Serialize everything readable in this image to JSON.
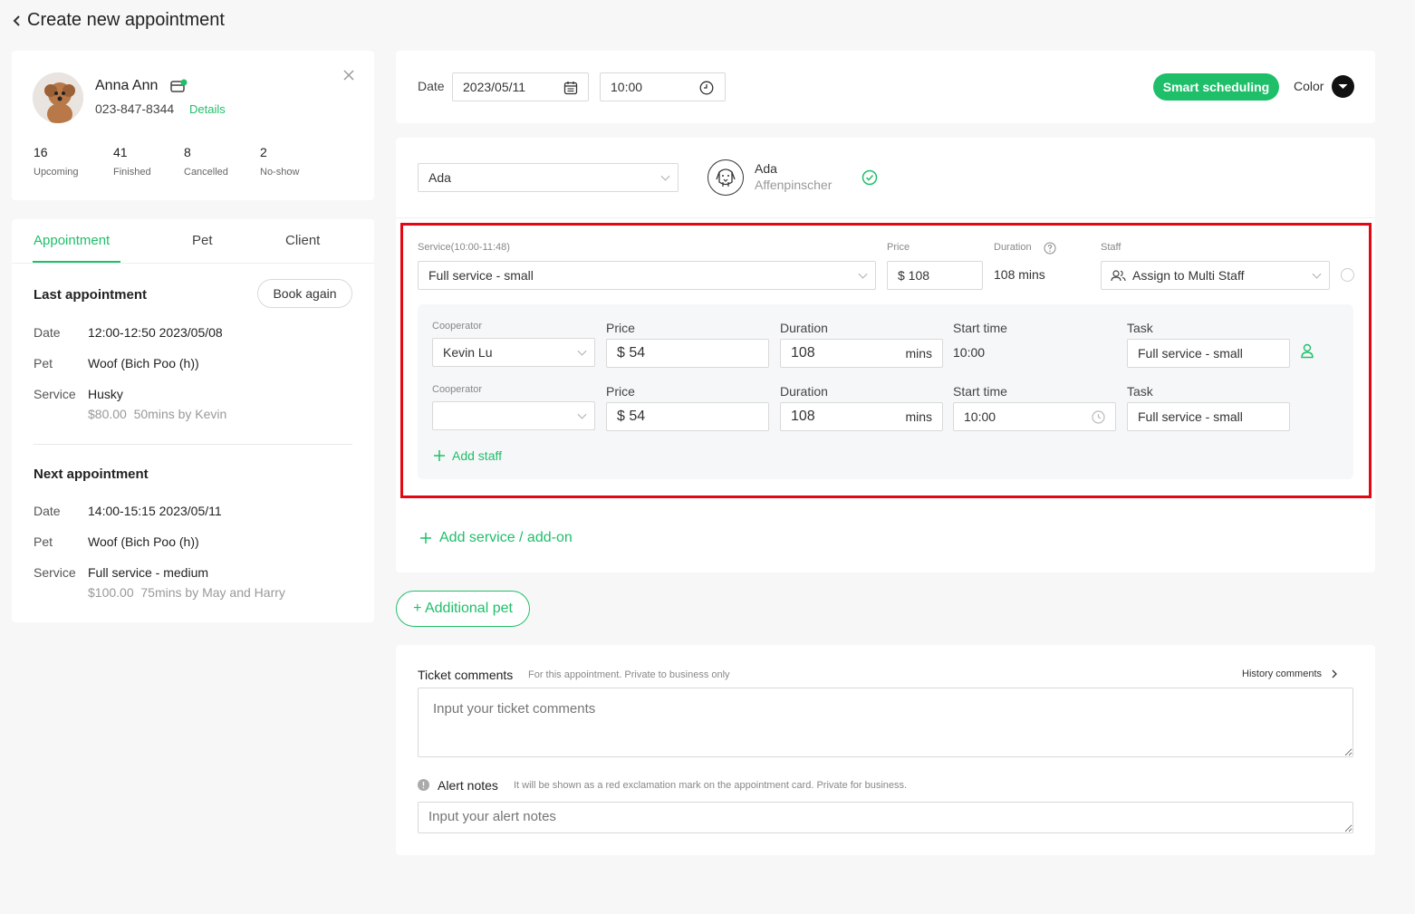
{
  "header": {
    "title": "Create new appointment"
  },
  "client": {
    "name": "Anna Ann",
    "phone": "023-847-8344",
    "details_link": "Details",
    "stats": [
      {
        "value": "16",
        "label": "Upcoming"
      },
      {
        "value": "41",
        "label": "Finished"
      },
      {
        "value": "8",
        "label": "Cancelled"
      },
      {
        "value": "2",
        "label": "No-show"
      }
    ]
  },
  "tabs": [
    "Appointment",
    "Pet",
    "Client"
  ],
  "last_appointment": {
    "title": "Last appointment",
    "book_again": "Book again",
    "date_label": "Date",
    "date": "12:00-12:50 2023/05/08",
    "pet_label": "Pet",
    "pet": "Woof (Bich Poo (h))",
    "service_label": "Service",
    "service": "Husky",
    "service_detail": "$80.00  50mins by Kevin"
  },
  "next_appointment": {
    "title": "Next appointment",
    "date_label": "Date",
    "date": "14:00-15:15 2023/05/11",
    "pet_label": "Pet",
    "pet": "Woof (Bich Poo (h))",
    "service_label": "Service",
    "service": "Full service - medium",
    "service_detail": "$100.00  75mins by May and Harry"
  },
  "schedule": {
    "date_label": "Date",
    "date": "2023/05/11",
    "time": "10:00",
    "smart_button": "Smart scheduling",
    "color_label": "Color"
  },
  "pet": {
    "select": "Ada",
    "name": "Ada",
    "breed": "Affenpinscher"
  },
  "service": {
    "service_label": "Service(10:00-11:48)",
    "service_value": "Full service - small",
    "price_label": "Price",
    "price_value": "$ 108",
    "duration_label": "Duration",
    "duration_value": "108 mins",
    "staff_label": "Staff",
    "staff_value": "Assign to Multi Staff"
  },
  "staff_rows": [
    {
      "cooperator_label": "Cooperator",
      "cooperator": "Kevin Lu",
      "price_label": "Price",
      "price": "$ 54",
      "duration_label": "Duration",
      "duration": "108",
      "unit": "mins",
      "start_label": "Start time",
      "start": "10:00",
      "task_label": "Task",
      "task": "Full service - small"
    },
    {
      "cooperator_label": "Cooperator",
      "cooperator": "",
      "price_label": "Price",
      "price": "$ 54",
      "duration_label": "Duration",
      "duration": "108",
      "unit": "mins",
      "start_label": "Start time",
      "start": "10:00",
      "task_label": "Task",
      "task": "Full service - small"
    }
  ],
  "add_staff": "Add staff",
  "add_service": "Add service / add-on",
  "additional_pet": "+ Additional pet",
  "comments": {
    "title": "Ticket comments",
    "hint": "For this appointment. Private to business only",
    "history": "History comments",
    "placeholder": "Input your ticket comments",
    "alert_title": "Alert notes",
    "alert_hint": "It will be shown as a red exclamation mark on the appointment card. Private for business.",
    "alert_placeholder": "Input your alert notes"
  },
  "colors": {
    "accent": "#1fbf6a",
    "highlight": "#e30613"
  }
}
